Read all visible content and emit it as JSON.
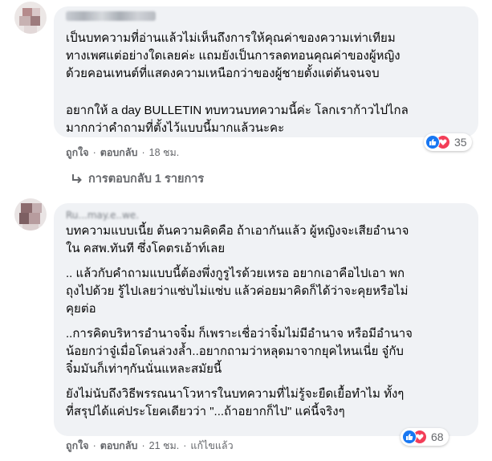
{
  "comments": [
    {
      "author_blurred": "",
      "paragraphs": [
        [
          "เป็นบทความที่อ่านแล้วไม่เห็นถึงการให้คุณค่าของความเท่าเทียม",
          "ทางเพศแต่อย่างใดเลยค่ะ แถมยังเป็นการลดทอนคุณค่าของผู้หญิง",
          "ด้วยคอนเทนต์ที่แสดงความเหนือกว่าของผู้ชายตั้งแต่ต้นจนจบ"
        ],
        [
          "อยากให้ a day BULLETIN ทบทวนบทความนี้ค่ะ โลกเราก้าวไปไกล",
          "มากกว่าคำถามที่ตั้งไว้แบบนี้มากแล้วนะคะ"
        ]
      ],
      "like_label": "ถูกใจ",
      "reply_label": "ตอบกลับ",
      "time": "18 ชม.",
      "reaction_count": "35",
      "replies_label": "การตอบกลับ 1 รายการ"
    },
    {
      "author_blurred": "Ru...may.e..we.",
      "paragraphs": [
        [
          "บทความแบบเนี้ย ต้นความคิดคือ ถ้าเอากันแล้ว ผู้หญิงจะเสียอำนาจ",
          "ใน คสพ.ทันที ซึ่งโคตรเอ้าท์เลย"
        ],
        [
          ".. แล้วกับคำถามแบบนี้ต้องพึ่งกูรูไรด้วยเหรอ อยากเอาคือไปเอา พก",
          "ถุงไปด้วย รู้ไปเลยว่าแซ่บไม่แซ่บ แล้วค่อยมาคิดก็ได้ว่าจะคุยหรือไม่",
          "คุยต่อ"
        ],
        [
          "..การคิดบริหารอำนาจจิ๋ม ก็เพราะเชื่อว่าจิ๋มไม่มีอำนาจ หรือมีอำนาจ",
          "น้อยกว่าจู๋เมื่อโดนล่วงล้ำ..อยากถามว่าหลุดมาจากยุคไหนเนี่ย จู๋กับ",
          "จิ๋มมันก็เท่าๆกันนั่นแหละสมัยนี้"
        ],
        [
          "ยังไม่นับถึงวิธีพรรณนาโวหารในบทความที่ไม่รู้จะยืดเยื้อทำไม ทั้งๆ",
          "ที่สรุปได้แค่ประโยคเดียวว่า \"...ถ้าอยากก็ไป\" แค่นี้จริงๆ"
        ]
      ],
      "like_label": "ถูกใจ",
      "reply_label": "ตอบกลับ",
      "time": "21 ชม.",
      "edited_label": "แก้ไขแล้ว",
      "reaction_count": "68"
    }
  ],
  "separator": "·",
  "icons": {
    "like": "thumbs-up-icon",
    "love": "heart-icon",
    "reply_arrow": "reply-arrow-icon"
  },
  "colors": {
    "like": "#1877f2",
    "love": "#f33e58",
    "bubble": "#f0f2f5",
    "meta": "#65676b"
  }
}
